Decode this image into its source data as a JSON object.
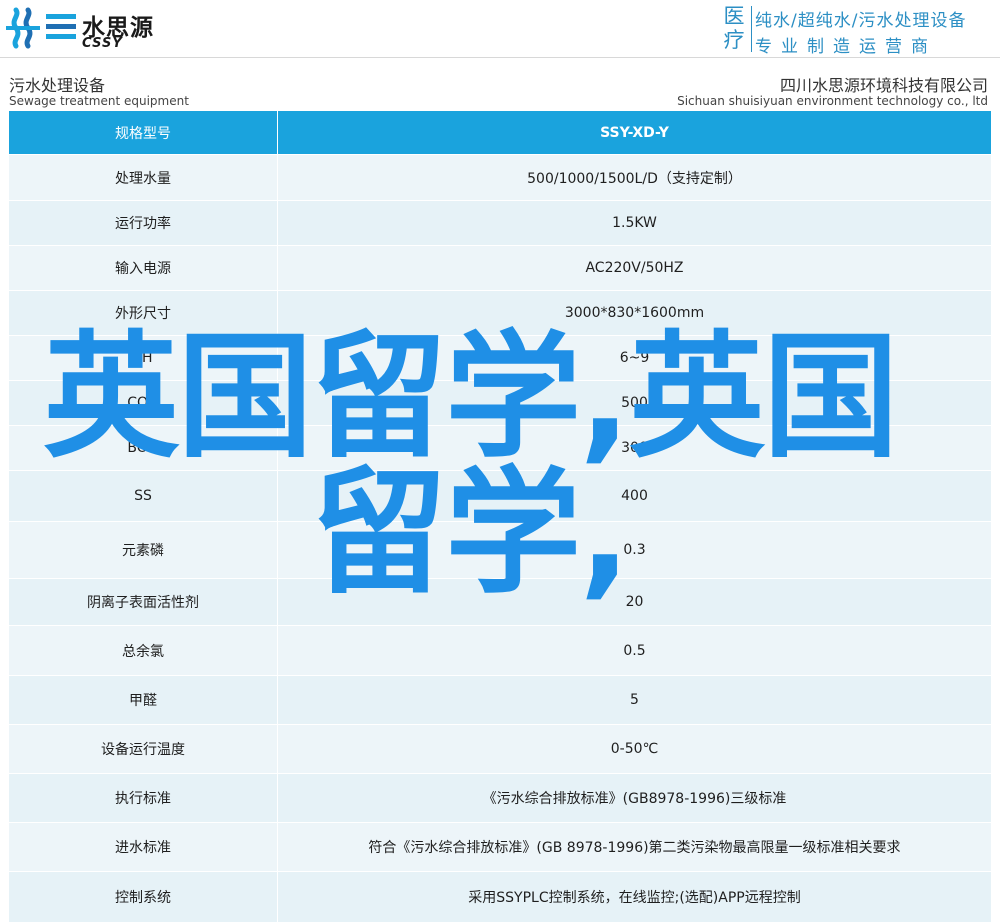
{
  "header": {
    "logo_cn": "水思源",
    "logo_en": "CSSY",
    "side_big": [
      "医",
      "疗"
    ],
    "line1": "纯水/超纯水/污水处理设备",
    "line2": "专业制造运营商"
  },
  "subheader": {
    "left_cn": "污水处理设备",
    "left_en": "Sewage treatment equipment",
    "right_cn": "四川水思源环境科技有限公司",
    "right_en": "Sichuan shuisiyuan environment technology co., ltd"
  },
  "table": {
    "head": {
      "label": "规格型号",
      "value": "SSY-XD-Y"
    },
    "rows": [
      {
        "label": "处理水量",
        "value": "500/1000/1500L/D（支持定制）"
      },
      {
        "label": "运行功率",
        "value": "1.5KW"
      },
      {
        "label": "输入电源",
        "value": "AC220V/50HZ"
      },
      {
        "label": "外形尺寸",
        "value": "3000*830*1600mm"
      },
      {
        "label": "PH",
        "value": "6~9"
      },
      {
        "label": "COD",
        "value": "500"
      },
      {
        "label": "BOD",
        "value": "300"
      },
      {
        "label": "SS",
        "value": "400"
      },
      {
        "label": "元素磷",
        "value": "0.3"
      },
      {
        "label": "阴离子表面活性剂",
        "value": "20"
      },
      {
        "label": "总余氯",
        "value": "0.5"
      },
      {
        "label": "甲醛",
        "value": "5"
      },
      {
        "label": "设备运行温度",
        "value": "0-50℃"
      },
      {
        "label": "执行标准",
        "value": "《污水综合排放标准》(GB8978-1996)三级标准"
      },
      {
        "label": "进水标准",
        "value": "符合《污水综合排放标准》(GB 8978-1996)第二类污染物最高限量一级标准相关要求"
      },
      {
        "label": "控制系统",
        "value": "采用SSYPLC控制系统，在线监控;(选配)APP远程控制"
      }
    ]
  },
  "overlay_text": "英国留学,英国留学,",
  "colors": {
    "accent": "#1aa3dd",
    "overlay": "#1f8fe6",
    "row_bg": "#e6f2f7",
    "header_text": "#2c8fc4"
  },
  "icons": {
    "logo": "water-drop-logo-icon"
  }
}
